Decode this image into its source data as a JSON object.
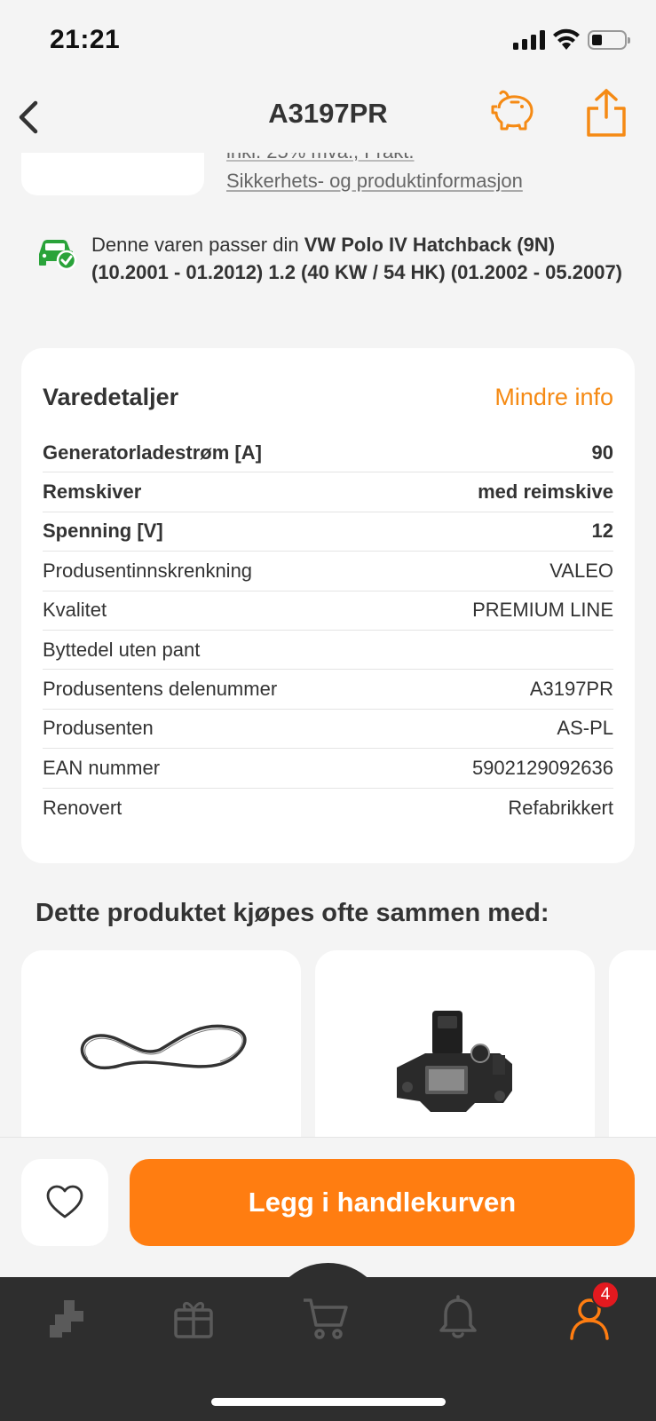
{
  "status_bar": {
    "time": "21:21"
  },
  "nav": {
    "title": "A3197PR"
  },
  "price_block": {
    "vat_text": "inkl. 25% mva., Frakt.",
    "safety_link": "Sikkerhets- og produktinformasjon"
  },
  "fitment": {
    "prefix": "Denne varen passer din ",
    "vehicle": "VW Polo IV Hatchback (9N) (10.2001 - 01.2012) 1.2 (40 KW / 54 HK) (01.2002 - 05.2007)"
  },
  "details": {
    "title": "Varedetaljer",
    "toggle_label": "Mindre info",
    "rows": [
      {
        "label": "Generatorladestrøm [A]",
        "value": "90"
      },
      {
        "label": "Remskiver",
        "value": "med reimskive"
      },
      {
        "label": "Spenning [V]",
        "value": "12"
      },
      {
        "label": "Produsentinnskrenkning",
        "value": "VALEO"
      },
      {
        "label": "Kvalitet",
        "value": "PREMIUM LINE"
      },
      {
        "label": "Byttedel uten pant",
        "value": ""
      },
      {
        "label": "Produsentens delenummer",
        "value": "A3197PR"
      },
      {
        "label": "Produsenten",
        "value": "AS-PL"
      },
      {
        "label": "EAN nummer",
        "value": "5902129092636"
      },
      {
        "label": "Renovert",
        "value": "Refabrikkert"
      }
    ]
  },
  "together": {
    "title": "Dette produktet kjøpes ofte sammen med:"
  },
  "action_bar": {
    "add_to_cart_label": "Legg i handlekurven"
  },
  "tab_bar": {
    "profile_badge": "4"
  },
  "colors": {
    "accent": "#ff7d11",
    "accent_text": "#f58a14",
    "fit_green": "#2aa33a",
    "badge_red": "#e3191f",
    "tab_bg": "#2e2e2e"
  },
  "icons": [
    "back-chevron-icon",
    "piggy-bank-icon",
    "share-icon",
    "car-check-icon",
    "heart-icon",
    "parts-icon",
    "gift-icon",
    "cart-icon",
    "bell-icon",
    "profile-icon"
  ]
}
